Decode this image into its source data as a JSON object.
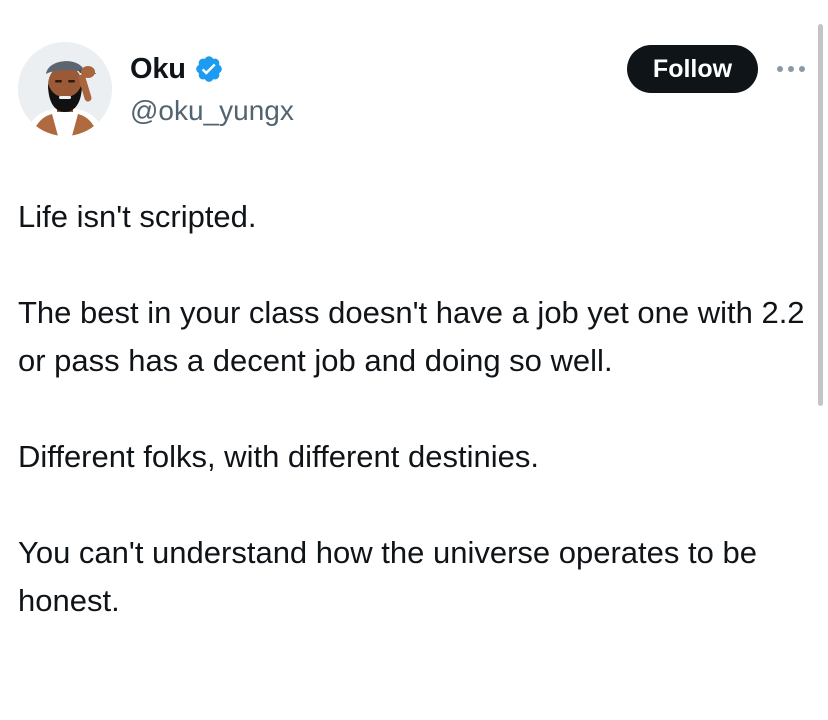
{
  "author": {
    "display_name": "Oku",
    "handle": "@oku_yungx",
    "verified": true,
    "verified_color": "#1d9bf0"
  },
  "actions": {
    "follow_label": "Follow",
    "more_icon": "more-horizontal-icon"
  },
  "tweet": {
    "paragraphs": [
      "Life isn't scripted.",
      "The best in your class doesn't have a job yet one with 2.2 or pass has a decent job and doing so well.",
      "Different folks, with different destinies.",
      "You can't understand how the universe operates to be honest."
    ]
  },
  "colors": {
    "text": "#0f1419",
    "secondary_text": "#536471",
    "button_bg": "#0f1419",
    "button_text": "#ffffff"
  }
}
